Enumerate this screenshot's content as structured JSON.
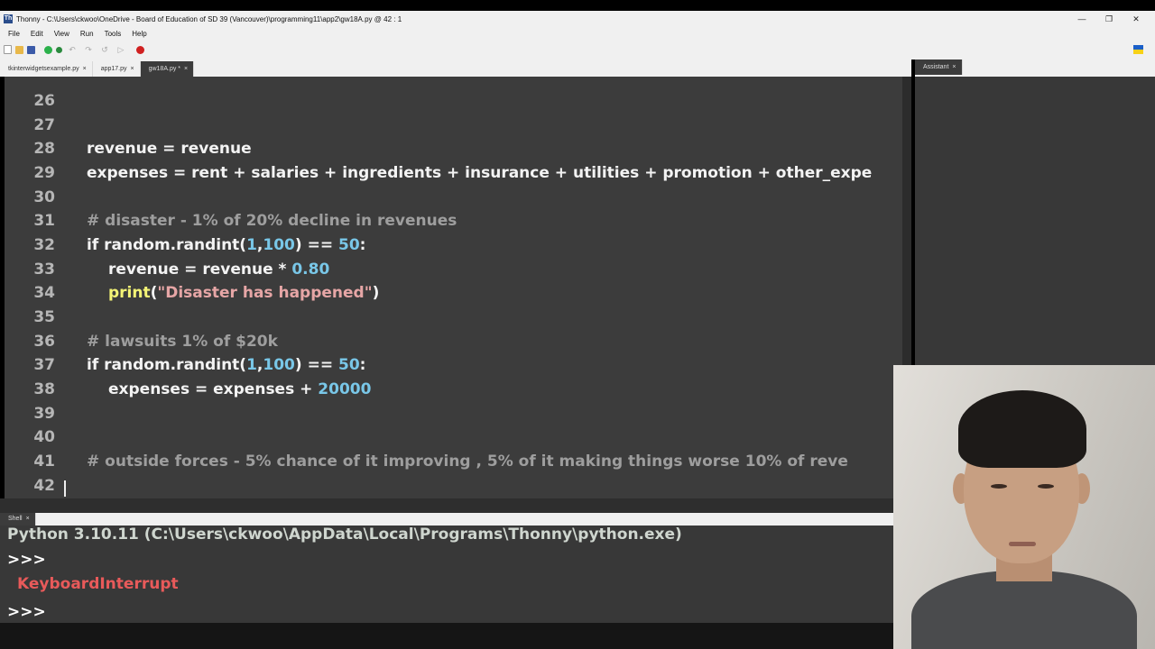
{
  "window": {
    "app_icon": "Th",
    "title": "Thonny  -  C:\\Users\\ckwoo\\OneDrive - Board of Education of SD 39 (Vancouver)\\programming11\\app2\\gw18A.py  @  42 : 1",
    "minimize": "—",
    "restore": "❐",
    "close": "✕"
  },
  "menu": [
    "File",
    "Edit",
    "View",
    "Run",
    "Tools",
    "Help"
  ],
  "toolbar_icons": [
    "new-file-icon",
    "open-file-icon",
    "save-file-icon",
    "run-icon",
    "debug-icon",
    "step-over-icon",
    "step-into-icon",
    "step-out-icon",
    "resume-icon",
    "stop-icon"
  ],
  "tabs": [
    {
      "label": "tkinterwidgetsexample.py",
      "close": "×",
      "active": false
    },
    {
      "label": "app17.py",
      "close": "×",
      "active": false
    },
    {
      "label": "gw18A.py *",
      "close": "×",
      "active": true
    }
  ],
  "assistant_tab": {
    "label": "Assistant",
    "close": "×"
  },
  "editor": {
    "line_numbers": [
      "26",
      "27",
      "28",
      "29",
      "30",
      "31",
      "32",
      "33",
      "34",
      "35",
      "36",
      "37",
      "38",
      "39",
      "40",
      "41",
      "42"
    ],
    "l28": "revenue = revenue",
    "l29": "expenses = rent + salaries + ingredients + insurance + utilities + promotion + other_expe",
    "l31": "# disaster - 1% of 20% decline in revenues",
    "l32_a": "if random.randint(",
    "l32_n1": "1",
    "l32_b": ",",
    "l32_n2": "100",
    "l32_c": ") == ",
    "l32_n3": "50",
    "l32_d": ":",
    "l33_a": "revenue = revenue * ",
    "l33_n": "0.80",
    "l34_fn": "print",
    "l34_p1": "(",
    "l34_s": "\"Disaster has happened\"",
    "l34_p2": ")",
    "l36": "# lawsuits  1% of $20k",
    "l37_a": "if random.randint(",
    "l37_n1": "1",
    "l37_b": ",",
    "l37_n2": "100",
    "l37_c": ") == ",
    "l37_n3": "50",
    "l37_d": ":",
    "l38_a": "expenses = expenses + ",
    "l38_n": "20000",
    "l41": "# outside forces - 5% chance of it improving , 5% of it making things worse   10% of reve"
  },
  "shell_tab": {
    "label": "Shell",
    "close": "×"
  },
  "shell": {
    "version": "Python 3.10.11 (C:\\Users\\ckwoo\\AppData\\Local\\Programs\\Thonny\\python.exe)",
    "prompt": ">>>",
    "error": "KeyboardInterrupt"
  },
  "colors": {
    "editor_bg": "#3c3c3c",
    "comment": "#9e9e9e",
    "number": "#79c7e8",
    "builtin": "#f4f476",
    "string": "#e6a6a6",
    "error": "#e85a5a",
    "flag_blue": "#1a5fc8",
    "flag_yellow": "#f7d118"
  }
}
